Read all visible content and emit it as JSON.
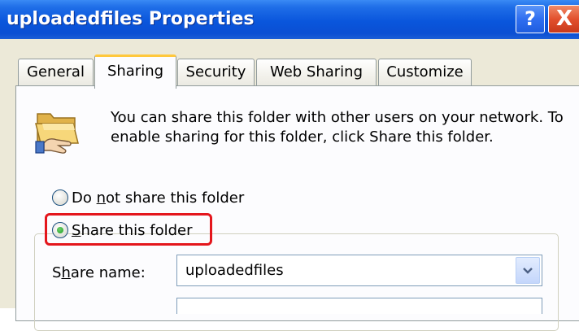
{
  "window": {
    "title": "uploadedfiles Properties",
    "help_glyph": "?",
    "close_glyph": "X"
  },
  "tabs": [
    {
      "label": "General",
      "active": false
    },
    {
      "label": "Sharing",
      "active": true
    },
    {
      "label": "Security",
      "active": false
    },
    {
      "label": "Web Sharing",
      "active": false
    },
    {
      "label": "Customize",
      "active": false
    }
  ],
  "sharing": {
    "folder_icon": "shared-folder-icon",
    "description": "You can share this folder with other users on your network.  To enable sharing for this folder, click Share this folder.",
    "option_do_not_share": {
      "prefix": "Do ",
      "accel": "n",
      "suffix": "ot share this folder",
      "selected": false
    },
    "option_share": {
      "accel": "S",
      "suffix": "hare this folder",
      "selected": true
    },
    "share_name_label": {
      "prefix": "S",
      "accel": "h",
      "suffix": "are name:"
    },
    "share_name_value": "uploadedfiles",
    "highlight_color": "#e4161c"
  }
}
